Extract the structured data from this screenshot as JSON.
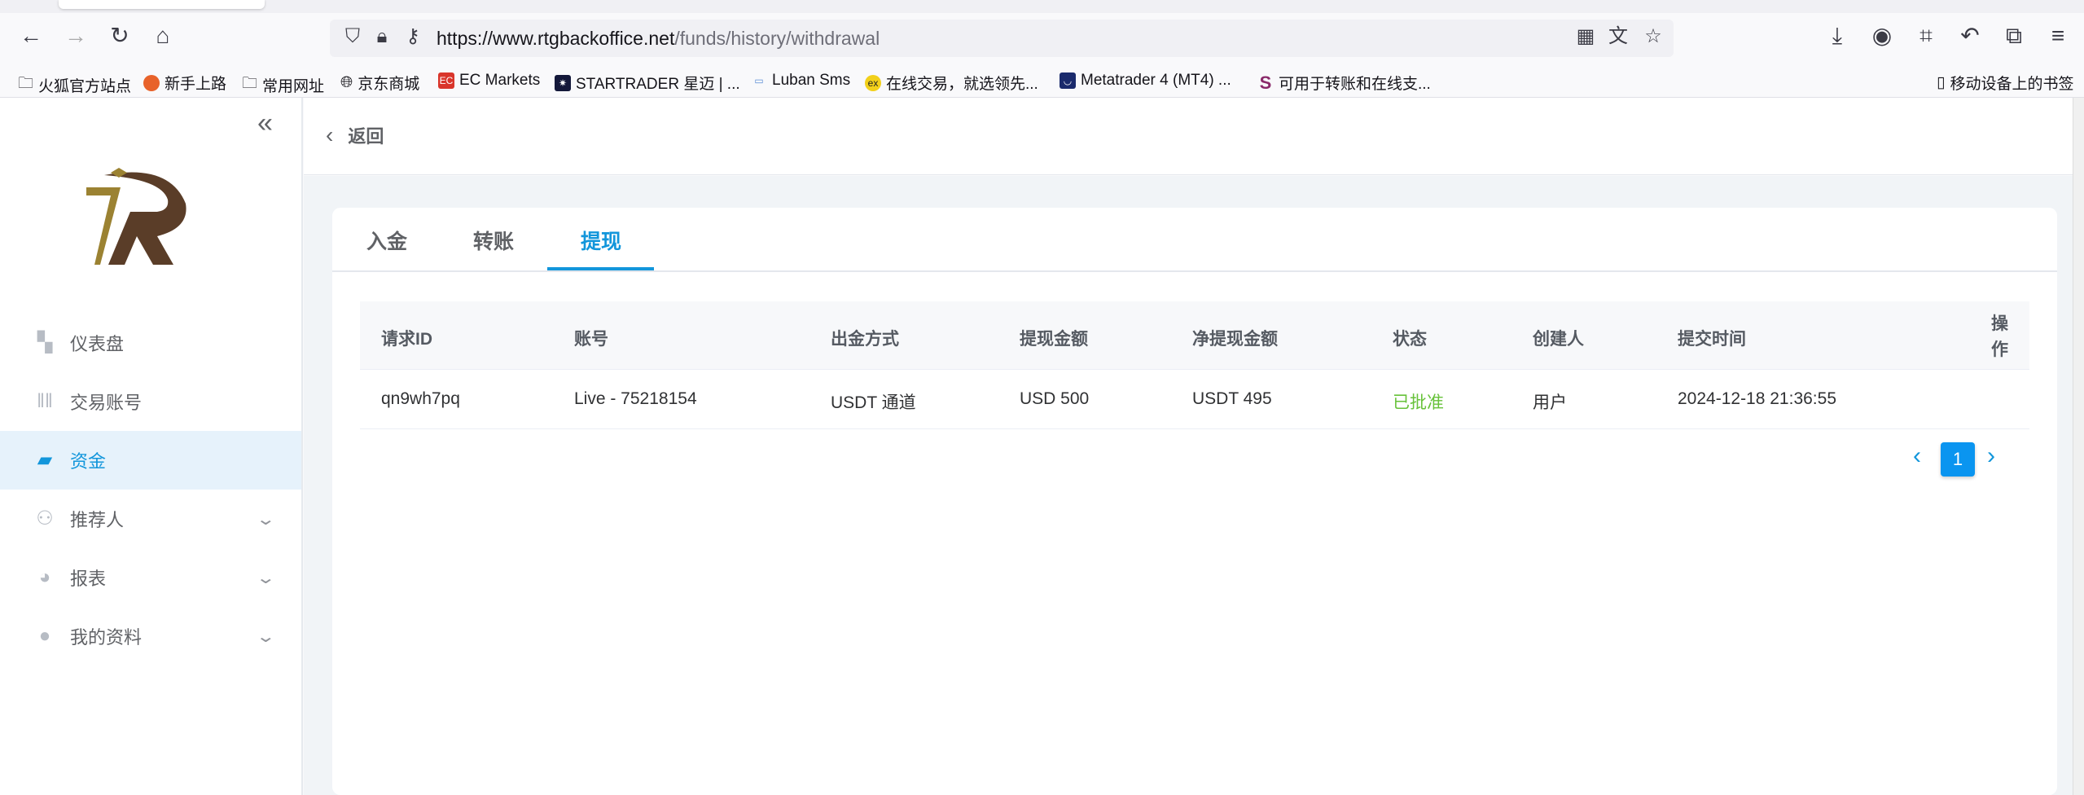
{
  "browser": {
    "url_domain": "https://www.rtgbackoffice.net",
    "url_path": "/funds/history/withdrawal",
    "bookmarks": [
      "火狐官方站点",
      "新手上路",
      "常用网址",
      "京东商城",
      "EC Markets",
      "STARTRADER 星迈 | ...",
      "Luban Sms",
      "在线交易，就选领先...",
      "Metatrader 4 (MT4) ...",
      "可用于转账和在线支..."
    ],
    "mobile_bookmarks": "移动设备上的书签"
  },
  "sidebar": {
    "items": [
      {
        "label": "仪表盘",
        "icon": "dashboard-icon"
      },
      {
        "label": "交易账号",
        "icon": "candlestick-icon"
      },
      {
        "label": "资金",
        "icon": "wallet-icon",
        "active": true
      },
      {
        "label": "推荐人",
        "icon": "users-icon",
        "expandable": true
      },
      {
        "label": "报表",
        "icon": "pie-chart-icon",
        "expandable": true
      },
      {
        "label": "我的资料",
        "icon": "user-icon",
        "expandable": true
      }
    ]
  },
  "header": {
    "back_label": "返回"
  },
  "tabs": [
    "入金",
    "转账",
    "提现"
  ],
  "active_tab": "提现",
  "table": {
    "columns": [
      "请求ID",
      "账号",
      "出金方式",
      "提现金额",
      "净提现金额",
      "状态",
      "创建人",
      "提交时间",
      "操作"
    ],
    "rows": [
      [
        "qn9wh7pq",
        "Live - 75218154",
        "USDT 通道",
        "USD 500",
        "USDT 495",
        "已批准",
        "用户",
        "2024-12-18 21:36:55",
        ""
      ]
    ]
  },
  "pagination": {
    "current": "1"
  },
  "colors": {
    "accent": "#1296db",
    "status_approved": "#67c23a"
  }
}
